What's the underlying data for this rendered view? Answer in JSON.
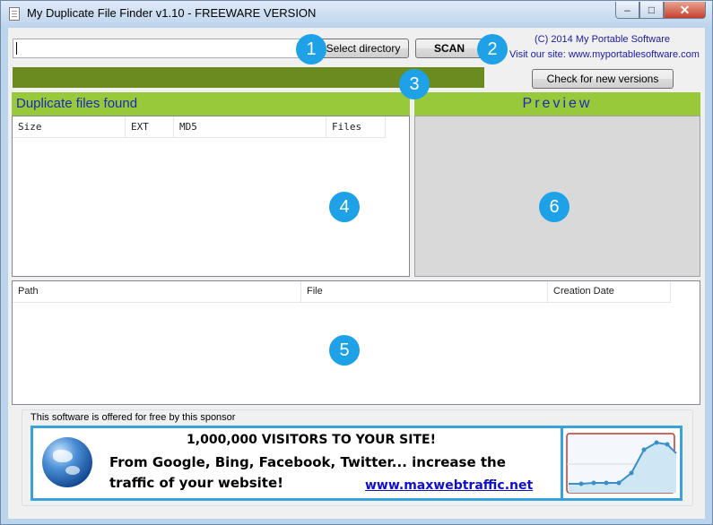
{
  "window": {
    "title": "My Duplicate File Finder v1.10 - FREEWARE VERSION",
    "controls": {
      "minimize": "–",
      "maximize": "□",
      "close": "✕"
    }
  },
  "toolbar": {
    "directory_value": "",
    "select_directory_label": "Select directory",
    "scan_label": "SCAN",
    "check_versions_label": "Check for new versions",
    "copyright": "(C) 2014 My Portable Software",
    "site": "Visit our site: www.myportablesoftware.com"
  },
  "duplicates": {
    "title": "Duplicate files found",
    "columns": [
      "Size",
      "EXT",
      "MD5",
      "Files"
    ]
  },
  "preview": {
    "title": "Preview"
  },
  "files": {
    "columns": [
      "Path",
      "File",
      "Creation Date"
    ]
  },
  "sponsor": {
    "label": "This software is offered for free by this sponsor",
    "headline": "1,000,000 VISITORS TO YOUR SITE!",
    "body": "From Google, Bing, Facebook, Twitter... increase the traffic of your website!",
    "link": "www.maxwebtraffic.net"
  },
  "markers": [
    "1",
    "2",
    "3",
    "4",
    "5",
    "6"
  ],
  "colors": {
    "accent_green": "#97c93b",
    "progress_green": "#6b8a1f",
    "header_text_blue": "#1c2cb0",
    "marker_blue": "#1ea1e6",
    "banner_border": "#3aa2d8"
  }
}
